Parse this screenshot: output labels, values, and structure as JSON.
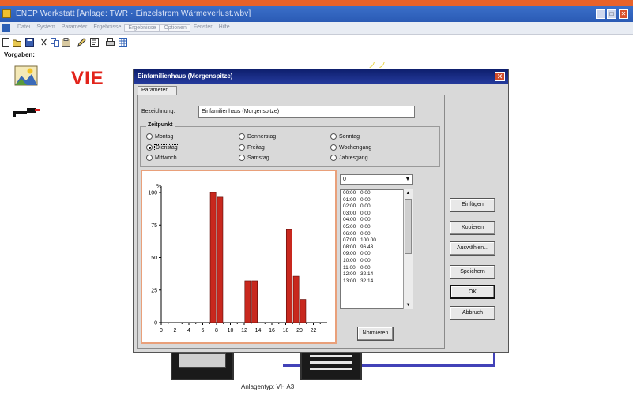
{
  "window": {
    "title": "ENEP Werkstatt [Anlage: TWR · Einzelstrom Wärmeverlust.wbv]",
    "controls": {
      "minimize": "_",
      "maximize": "□",
      "close": "✕"
    }
  },
  "menubar": {
    "items": [
      "Datei",
      "System",
      "Parameter",
      "Ergebnisse",
      "Ergebnisse",
      "Optionen",
      "Fenster",
      "Hilfe"
    ]
  },
  "sidebar": {
    "label": "Vorgaben:"
  },
  "logo": {
    "text": "VIE"
  },
  "dialog": {
    "title": "Einfamilienhaus (Morgenspitze)",
    "tab": "Parameter",
    "bezeichnung_label": "Bezeichnung:",
    "bezeichnung_value": "Einfamilienhaus (Morgenspitze)",
    "zeitpunkt_label": "Zeitpunkt",
    "radios": [
      {
        "label": "Montag",
        "checked": false
      },
      {
        "label": "Dienstag",
        "checked": true
      },
      {
        "label": "Mittwoch",
        "checked": false
      },
      {
        "label": "Donnerstag",
        "checked": false
      },
      {
        "label": "Freitag",
        "checked": false
      },
      {
        "label": "Samstag",
        "checked": false
      },
      {
        "label": "Sonntag",
        "checked": false
      },
      {
        "label": "Wochengang",
        "checked": false
      },
      {
        "label": "Jahresgang",
        "checked": false
      }
    ],
    "combo_value": "0",
    "combo_arrow": "▼",
    "list": [
      [
        "00:00",
        "0.00"
      ],
      [
        "01:00",
        "0.00"
      ],
      [
        "02:00",
        "0.00"
      ],
      [
        "03:00",
        "0.00"
      ],
      [
        "04:00",
        "0.00"
      ],
      [
        "05:00",
        "0.00"
      ],
      [
        "06:00",
        "0.00"
      ],
      [
        "07:00",
        "100.00"
      ],
      [
        "08:00",
        "96.43"
      ],
      [
        "09:00",
        "0.00"
      ],
      [
        "10:00",
        "0.00"
      ],
      [
        "11:00",
        "0.00"
      ],
      [
        "12:00",
        "32.14"
      ],
      [
        "13:00",
        "32.14"
      ]
    ],
    "buttons": {
      "normieren": "Normieren",
      "einfuegen": "Einfügen",
      "kopieren": "Kopieren",
      "auswaehlen": "Auswählen...",
      "speichern": "Speichern",
      "ok": "OK",
      "abbruch": "Abbruch"
    }
  },
  "chart_data": {
    "type": "bar",
    "x": [
      7,
      8,
      12,
      13,
      18,
      19,
      20
    ],
    "values": [
      100,
      96.43,
      32.14,
      32.14,
      71.43,
      35.71,
      17.86
    ],
    "xticks": [
      "0",
      "2",
      "4",
      "6",
      "8",
      "10",
      "12",
      "14",
      "16",
      "18",
      "20",
      "22"
    ],
    "yticks": [
      "0",
      "25",
      "50",
      "75",
      "100"
    ],
    "ylabel_unit": "%",
    "ylim": [
      0,
      100
    ],
    "xlim": [
      0,
      24
    ],
    "bar_color": "#c8281e"
  },
  "background": {
    "plant_caption": "Anlagentyp: VH A3"
  },
  "colors": {
    "banner": "#e8622a",
    "titlebar": "#2a5ab4",
    "dialog_title": "#0e1f6e",
    "pipe": "#4242b8",
    "logo": "#e2231a"
  }
}
